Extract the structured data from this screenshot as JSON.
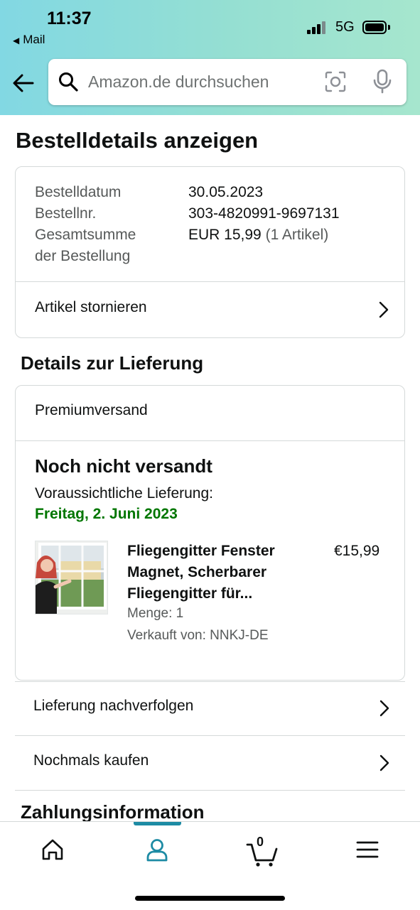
{
  "status_bar": {
    "time": "11:37",
    "back_app": "Mail",
    "network": "5G"
  },
  "search": {
    "placeholder": "Amazon.de durchsuchen",
    "value": ""
  },
  "page": {
    "title": "Bestelldetails anzeigen"
  },
  "order_summary": {
    "rows": [
      {
        "label": "Bestelldatum",
        "value": "30.05.2023"
      },
      {
        "label": "Bestellnr.",
        "value": "303-4820991-9697131"
      }
    ],
    "total_label_line1": "Gesamtsumme",
    "total_label_line2": "der Bestellung",
    "total_value": "EUR 15,99",
    "total_items": "(1 Artikel)",
    "cancel_label": "Artikel stornieren"
  },
  "delivery": {
    "section_title": "Details zur Lieferung",
    "shipping_type": "Premiumversand",
    "status": "Noch nicht versandt",
    "expected_label": "Voraussichtliche Lieferung:",
    "expected_date": "Freitag, 2. Juni 2023",
    "product": {
      "title_line1": "Fliegengitter Fenster",
      "title_line2": "Magnet, Scherbarer",
      "title_line3": "Fliegengitter für...",
      "price": "€15,99",
      "quantity": "Menge: 1",
      "seller": "Verkauft von: NNKJ-DE"
    }
  },
  "actions": [
    {
      "label": "Lieferung nachverfolgen"
    },
    {
      "label": "Nochmals kaufen"
    }
  ],
  "payment": {
    "section_title": "Zahlungsinformation"
  },
  "bottom_nav": {
    "cart_count": "0",
    "active_tab": "account",
    "accent_color": "#1d8ba4"
  },
  "colors": {
    "delivery_date": "#007600",
    "header_gradient_start": "#82d8e3",
    "header_gradient_end": "#a6e6ce"
  }
}
